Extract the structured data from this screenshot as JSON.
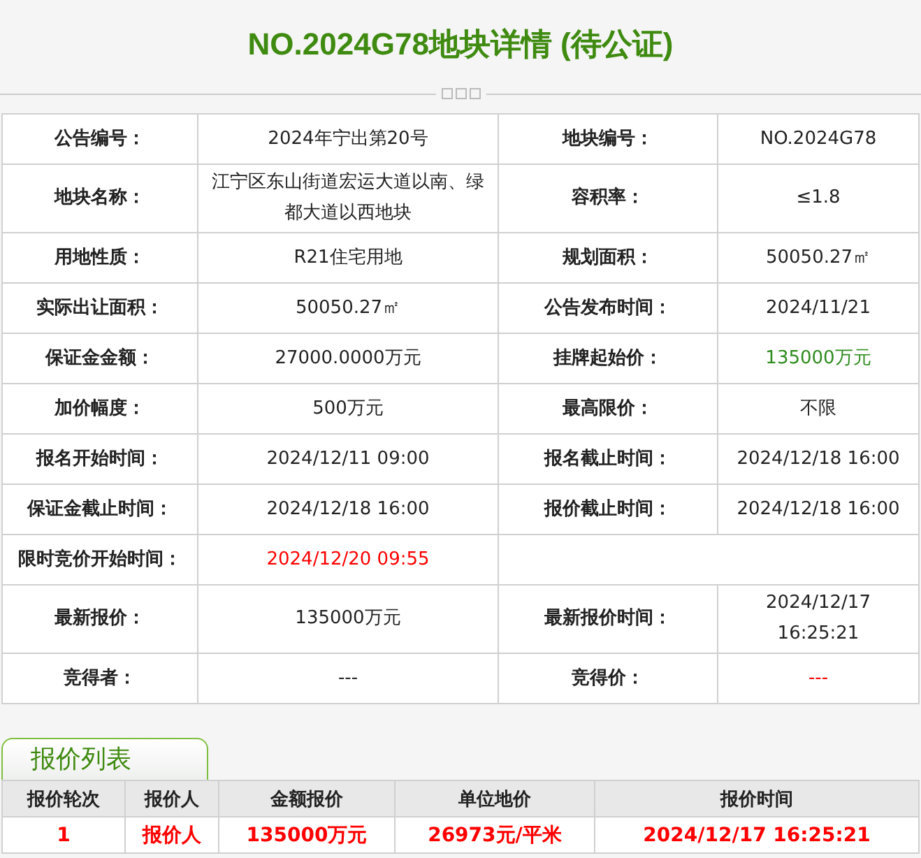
{
  "title": "NO.2024G78地块详情 (待公证)",
  "details": [
    {
      "cells": [
        {
          "kind": "label",
          "text": "公告编号："
        },
        {
          "kind": "value",
          "text": "2024年宁出第20号"
        },
        {
          "kind": "label",
          "text": "地块编号："
        },
        {
          "kind": "value",
          "text": "NO.2024G78"
        }
      ]
    },
    {
      "cells": [
        {
          "kind": "label",
          "text": "地块名称："
        },
        {
          "kind": "value",
          "text": "江宁区东山街道宏运大道以南、绿都大道以西地块"
        },
        {
          "kind": "label",
          "text": "容积率："
        },
        {
          "kind": "value",
          "text": "≤1.8"
        }
      ]
    },
    {
      "cells": [
        {
          "kind": "label",
          "text": "用地性质："
        },
        {
          "kind": "value",
          "text": "R21住宅用地"
        },
        {
          "kind": "label",
          "text": "规划面积："
        },
        {
          "kind": "value",
          "text": "50050.27㎡"
        }
      ]
    },
    {
      "cells": [
        {
          "kind": "label",
          "text": "实际出让面积："
        },
        {
          "kind": "value",
          "text": "50050.27㎡"
        },
        {
          "kind": "label",
          "text": "公告发布时间："
        },
        {
          "kind": "value",
          "text": "2024/11/21"
        }
      ]
    },
    {
      "cells": [
        {
          "kind": "label",
          "text": "保证金金额："
        },
        {
          "kind": "value",
          "text": "27000.0000万元"
        },
        {
          "kind": "label",
          "text": "挂牌起始价："
        },
        {
          "kind": "value",
          "text": "135000万元",
          "color": "#2e8b1e"
        }
      ]
    },
    {
      "cells": [
        {
          "kind": "label",
          "text": "加价幅度："
        },
        {
          "kind": "value",
          "text": "500万元"
        },
        {
          "kind": "label",
          "text": "最高限价："
        },
        {
          "kind": "value",
          "text": "不限"
        }
      ]
    },
    {
      "cells": [
        {
          "kind": "label",
          "text": "报名开始时间："
        },
        {
          "kind": "value",
          "text": "2024/12/11 09:00"
        },
        {
          "kind": "label",
          "text": "报名截止时间："
        },
        {
          "kind": "value",
          "text": "2024/12/18 16:00"
        }
      ]
    },
    {
      "cells": [
        {
          "kind": "label",
          "text": "保证金截止时间："
        },
        {
          "kind": "value",
          "text": "2024/12/18 16:00"
        },
        {
          "kind": "label",
          "text": "报价截止时间："
        },
        {
          "kind": "value",
          "text": "2024/12/18 16:00"
        }
      ]
    },
    {
      "cells": [
        {
          "kind": "label",
          "text": "限时竞价开始时间："
        },
        {
          "kind": "value",
          "text": "2024/12/20 09:55",
          "color": "#ff0000"
        }
      ]
    },
    {
      "cells": [
        {
          "kind": "label",
          "text": "最新报价："
        },
        {
          "kind": "value",
          "text": "135000万元"
        },
        {
          "kind": "label",
          "text": "最新报价时间："
        },
        {
          "kind": "value",
          "text": "2024/12/17 16:25:21"
        }
      ]
    },
    {
      "cells": [
        {
          "kind": "label",
          "text": "竞得者："
        },
        {
          "kind": "value",
          "text": "---"
        },
        {
          "kind": "label",
          "text": "竞得价："
        },
        {
          "kind": "value",
          "text": "---",
          "color": "#ff0000"
        }
      ]
    }
  ],
  "bids": {
    "tab": "报价列表",
    "columns": [
      "报价轮次",
      "报价人",
      "金额报价",
      "单位地价",
      "报价时间"
    ],
    "rows": [
      [
        "1",
        "报价人",
        "135000万元",
        "26973元/平米",
        "2024/12/17 16:25:21"
      ]
    ]
  }
}
